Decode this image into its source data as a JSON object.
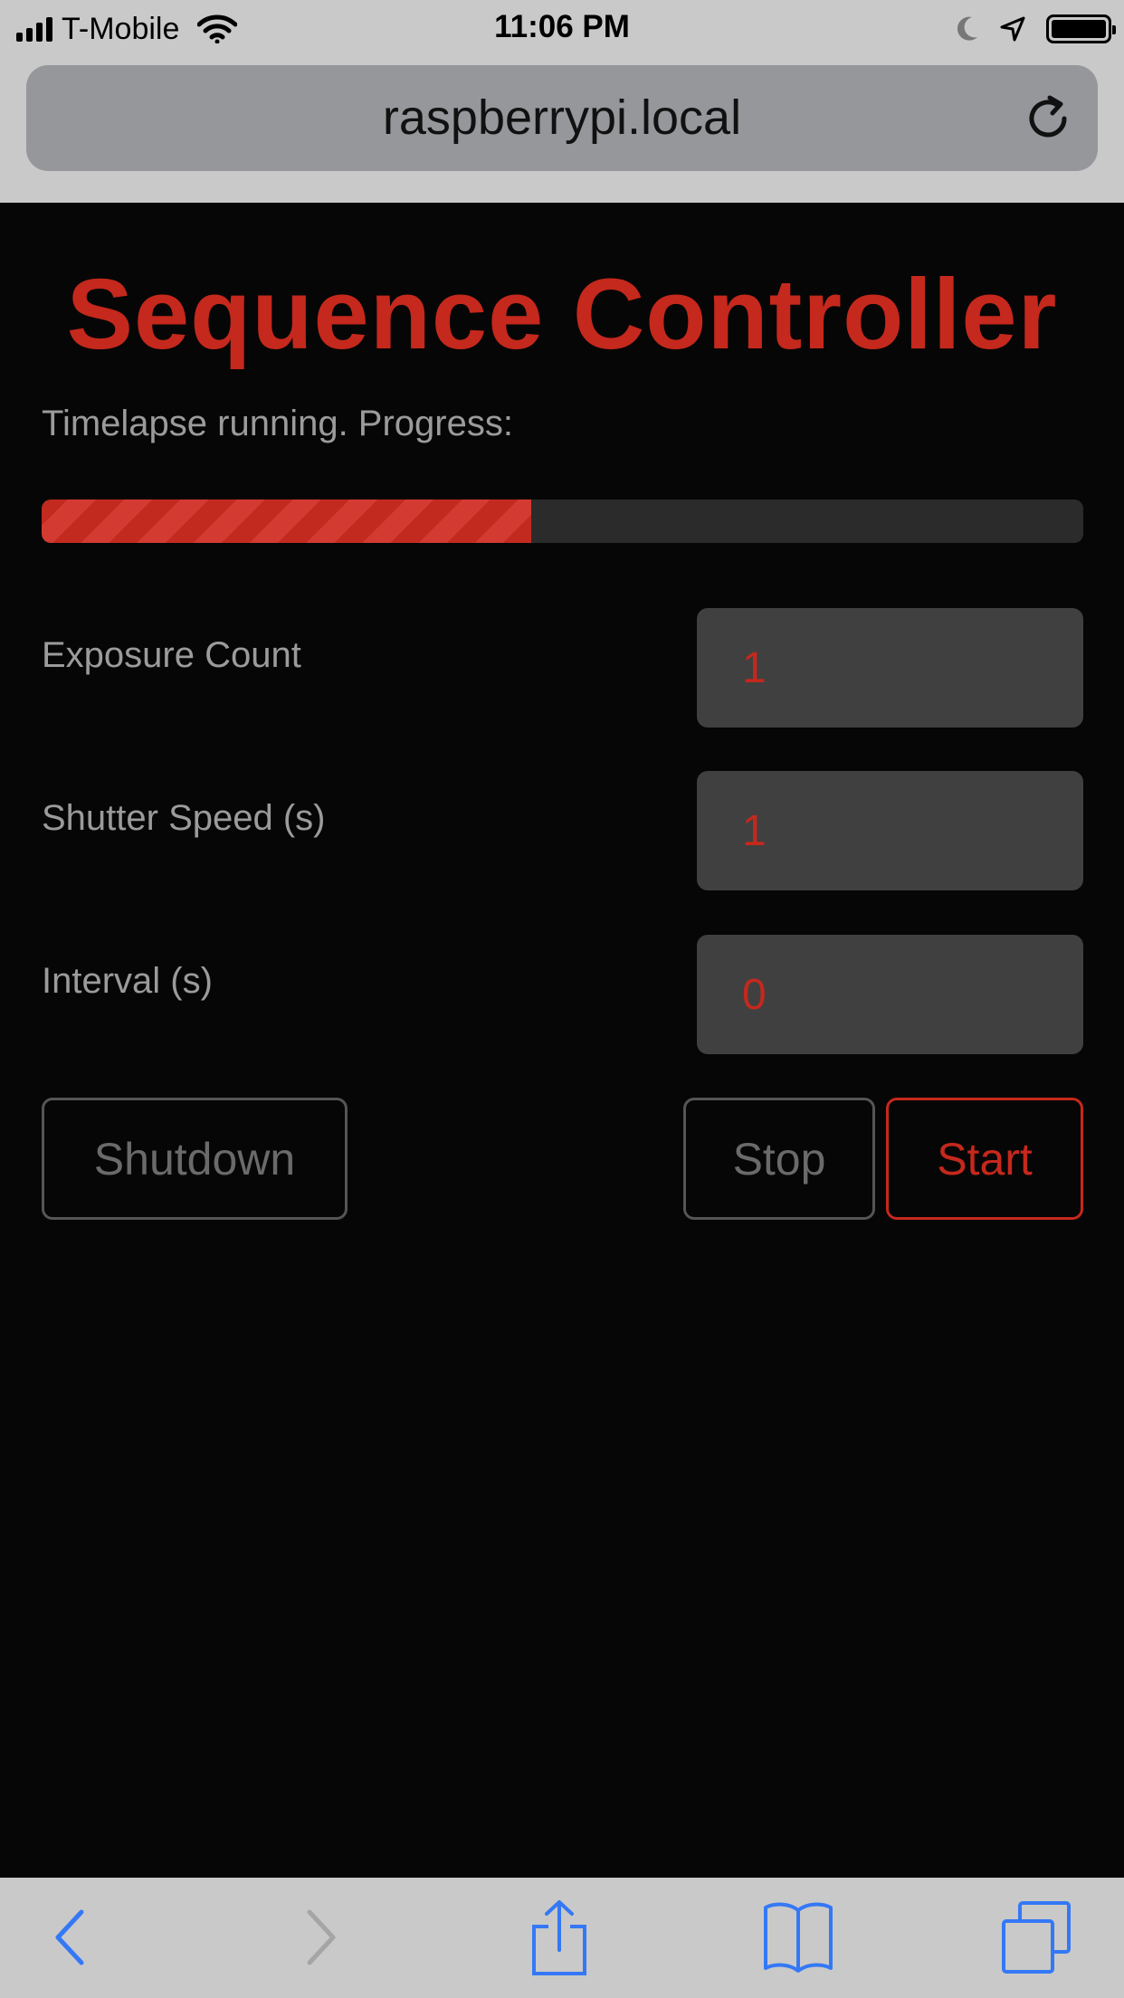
{
  "status_bar": {
    "carrier": "T-Mobile",
    "time": "11:06 PM",
    "battery_level": 1.0
  },
  "browser": {
    "url": "raspberrypi.local"
  },
  "page": {
    "title": "Sequence Controller",
    "status": "Timelapse running. Progress:",
    "progress": 0.47,
    "accent_color": "#c5281c",
    "fields": [
      {
        "label": "Exposure Count",
        "value": "1"
      },
      {
        "label": "Shutter Speed (s)",
        "value": "1"
      },
      {
        "label": "Interval (s)",
        "value": "0"
      }
    ],
    "buttons": {
      "shutdown": "Shutdown",
      "stop": "Stop",
      "start": "Start"
    }
  },
  "toolbar": {
    "icons": [
      "back-icon",
      "forward-icon",
      "share-icon",
      "bookmarks-icon",
      "tabs-icon"
    ],
    "icon_color": "#3478f6"
  }
}
